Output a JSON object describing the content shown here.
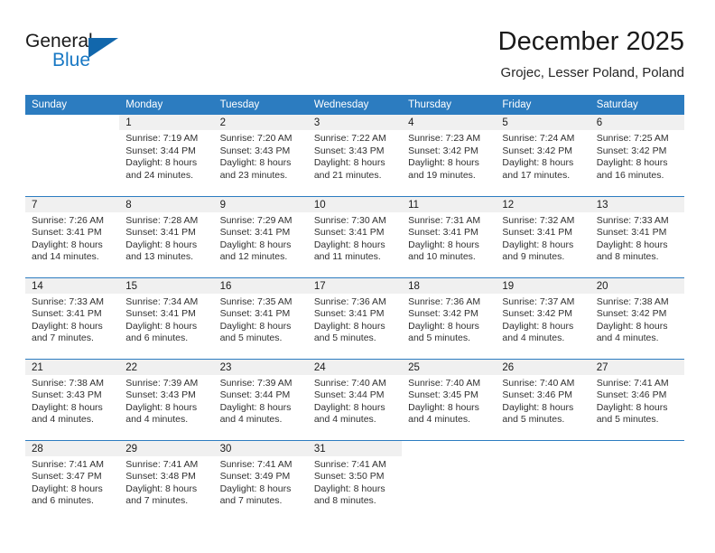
{
  "brand": {
    "name_part1": "General",
    "name_part2": "Blue",
    "logo_icon": "triangle-icon",
    "accent_color": "#1878c4",
    "header_color": "#2c7cc0"
  },
  "header": {
    "title": "December 2025",
    "location": "Grojec, Lesser Poland, Poland"
  },
  "calendar": {
    "weekday_headers": [
      "Sunday",
      "Monday",
      "Tuesday",
      "Wednesday",
      "Thursday",
      "Friday",
      "Saturday"
    ],
    "weeks": [
      [
        {
          "day": "",
          "lines": []
        },
        {
          "day": "1",
          "lines": [
            "Sunrise: 7:19 AM",
            "Sunset: 3:44 PM",
            "Daylight: 8 hours",
            "and 24 minutes."
          ]
        },
        {
          "day": "2",
          "lines": [
            "Sunrise: 7:20 AM",
            "Sunset: 3:43 PM",
            "Daylight: 8 hours",
            "and 23 minutes."
          ]
        },
        {
          "day": "3",
          "lines": [
            "Sunrise: 7:22 AM",
            "Sunset: 3:43 PM",
            "Daylight: 8 hours",
            "and 21 minutes."
          ]
        },
        {
          "day": "4",
          "lines": [
            "Sunrise: 7:23 AM",
            "Sunset: 3:42 PM",
            "Daylight: 8 hours",
            "and 19 minutes."
          ]
        },
        {
          "day": "5",
          "lines": [
            "Sunrise: 7:24 AM",
            "Sunset: 3:42 PM",
            "Daylight: 8 hours",
            "and 17 minutes."
          ]
        },
        {
          "day": "6",
          "lines": [
            "Sunrise: 7:25 AM",
            "Sunset: 3:42 PM",
            "Daylight: 8 hours",
            "and 16 minutes."
          ]
        }
      ],
      [
        {
          "day": "7",
          "lines": [
            "Sunrise: 7:26 AM",
            "Sunset: 3:41 PM",
            "Daylight: 8 hours",
            "and 14 minutes."
          ]
        },
        {
          "day": "8",
          "lines": [
            "Sunrise: 7:28 AM",
            "Sunset: 3:41 PM",
            "Daylight: 8 hours",
            "and 13 minutes."
          ]
        },
        {
          "day": "9",
          "lines": [
            "Sunrise: 7:29 AM",
            "Sunset: 3:41 PM",
            "Daylight: 8 hours",
            "and 12 minutes."
          ]
        },
        {
          "day": "10",
          "lines": [
            "Sunrise: 7:30 AM",
            "Sunset: 3:41 PM",
            "Daylight: 8 hours",
            "and 11 minutes."
          ]
        },
        {
          "day": "11",
          "lines": [
            "Sunrise: 7:31 AM",
            "Sunset: 3:41 PM",
            "Daylight: 8 hours",
            "and 10 minutes."
          ]
        },
        {
          "day": "12",
          "lines": [
            "Sunrise: 7:32 AM",
            "Sunset: 3:41 PM",
            "Daylight: 8 hours",
            "and 9 minutes."
          ]
        },
        {
          "day": "13",
          "lines": [
            "Sunrise: 7:33 AM",
            "Sunset: 3:41 PM",
            "Daylight: 8 hours",
            "and 8 minutes."
          ]
        }
      ],
      [
        {
          "day": "14",
          "lines": [
            "Sunrise: 7:33 AM",
            "Sunset: 3:41 PM",
            "Daylight: 8 hours",
            "and 7 minutes."
          ]
        },
        {
          "day": "15",
          "lines": [
            "Sunrise: 7:34 AM",
            "Sunset: 3:41 PM",
            "Daylight: 8 hours",
            "and 6 minutes."
          ]
        },
        {
          "day": "16",
          "lines": [
            "Sunrise: 7:35 AM",
            "Sunset: 3:41 PM",
            "Daylight: 8 hours",
            "and 5 minutes."
          ]
        },
        {
          "day": "17",
          "lines": [
            "Sunrise: 7:36 AM",
            "Sunset: 3:41 PM",
            "Daylight: 8 hours",
            "and 5 minutes."
          ]
        },
        {
          "day": "18",
          "lines": [
            "Sunrise: 7:36 AM",
            "Sunset: 3:42 PM",
            "Daylight: 8 hours",
            "and 5 minutes."
          ]
        },
        {
          "day": "19",
          "lines": [
            "Sunrise: 7:37 AM",
            "Sunset: 3:42 PM",
            "Daylight: 8 hours",
            "and 4 minutes."
          ]
        },
        {
          "day": "20",
          "lines": [
            "Sunrise: 7:38 AM",
            "Sunset: 3:42 PM",
            "Daylight: 8 hours",
            "and 4 minutes."
          ]
        }
      ],
      [
        {
          "day": "21",
          "lines": [
            "Sunrise: 7:38 AM",
            "Sunset: 3:43 PM",
            "Daylight: 8 hours",
            "and 4 minutes."
          ]
        },
        {
          "day": "22",
          "lines": [
            "Sunrise: 7:39 AM",
            "Sunset: 3:43 PM",
            "Daylight: 8 hours",
            "and 4 minutes."
          ]
        },
        {
          "day": "23",
          "lines": [
            "Sunrise: 7:39 AM",
            "Sunset: 3:44 PM",
            "Daylight: 8 hours",
            "and 4 minutes."
          ]
        },
        {
          "day": "24",
          "lines": [
            "Sunrise: 7:40 AM",
            "Sunset: 3:44 PM",
            "Daylight: 8 hours",
            "and 4 minutes."
          ]
        },
        {
          "day": "25",
          "lines": [
            "Sunrise: 7:40 AM",
            "Sunset: 3:45 PM",
            "Daylight: 8 hours",
            "and 4 minutes."
          ]
        },
        {
          "day": "26",
          "lines": [
            "Sunrise: 7:40 AM",
            "Sunset: 3:46 PM",
            "Daylight: 8 hours",
            "and 5 minutes."
          ]
        },
        {
          "day": "27",
          "lines": [
            "Sunrise: 7:41 AM",
            "Sunset: 3:46 PM",
            "Daylight: 8 hours",
            "and 5 minutes."
          ]
        }
      ],
      [
        {
          "day": "28",
          "lines": [
            "Sunrise: 7:41 AM",
            "Sunset: 3:47 PM",
            "Daylight: 8 hours",
            "and 6 minutes."
          ]
        },
        {
          "day": "29",
          "lines": [
            "Sunrise: 7:41 AM",
            "Sunset: 3:48 PM",
            "Daylight: 8 hours",
            "and 7 minutes."
          ]
        },
        {
          "day": "30",
          "lines": [
            "Sunrise: 7:41 AM",
            "Sunset: 3:49 PM",
            "Daylight: 8 hours",
            "and 7 minutes."
          ]
        },
        {
          "day": "31",
          "lines": [
            "Sunrise: 7:41 AM",
            "Sunset: 3:50 PM",
            "Daylight: 8 hours",
            "and 8 minutes."
          ]
        },
        {
          "day": "",
          "lines": []
        },
        {
          "day": "",
          "lines": []
        },
        {
          "day": "",
          "lines": []
        }
      ]
    ]
  }
}
